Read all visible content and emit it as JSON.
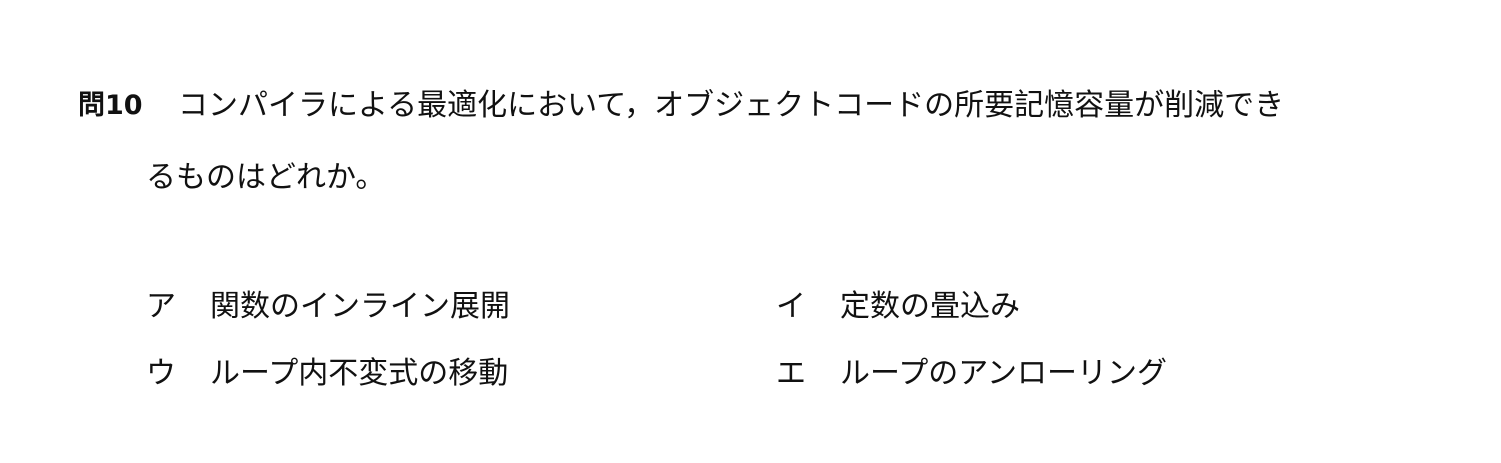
{
  "question": {
    "number": "問10",
    "line1": "コンパイラによる最適化において，オブジェクトコードの所要記憶容量が削減でき",
    "line2": "るものはどれか。"
  },
  "choices": [
    {
      "label": "ア",
      "text": "関数のインライン展開"
    },
    {
      "label": "イ",
      "text": "定数の畳込み"
    },
    {
      "label": "ウ",
      "text": "ループ内不変式の移動"
    },
    {
      "label": "エ",
      "text": "ループのアンローリング"
    }
  ]
}
